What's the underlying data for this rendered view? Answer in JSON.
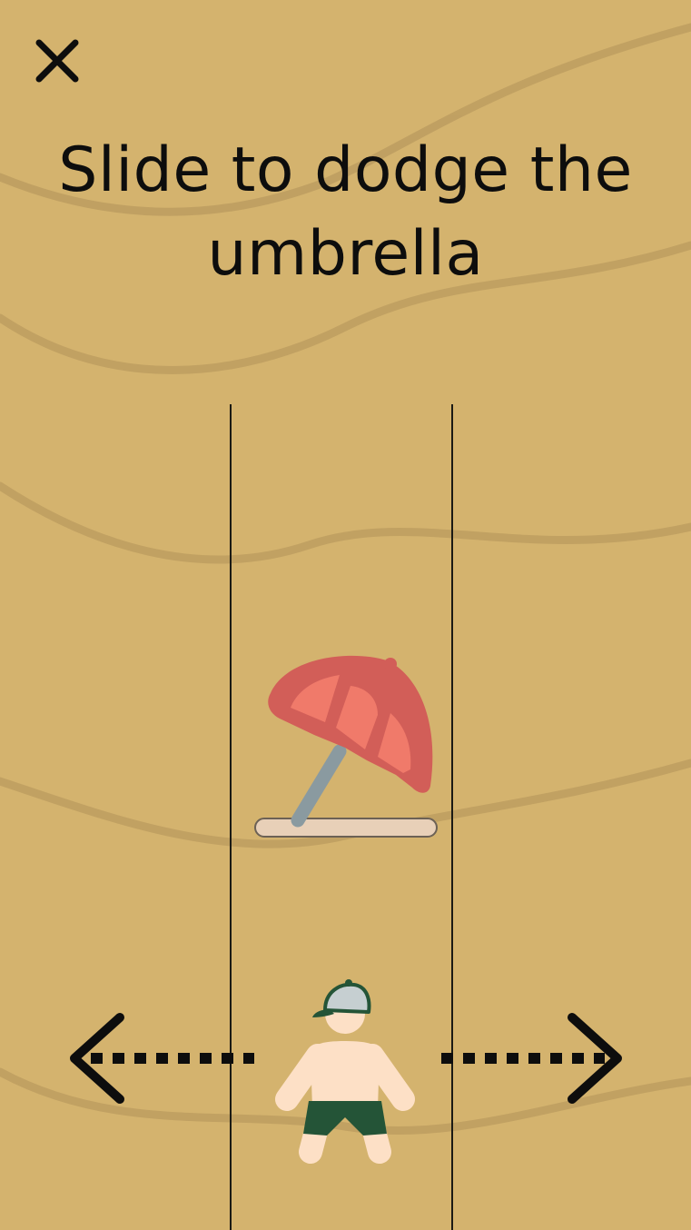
{
  "game": {
    "instruction": "Slide to dodge the umbrella",
    "close_icon": "close-icon",
    "lanes": 3,
    "umbrella_lane": "center",
    "player_lane": "center",
    "obstacle_icon": "beach-umbrella-icon",
    "player_icon": "beachgoer-icon",
    "controls": {
      "left_icon": "arrow-left-icon",
      "right_icon": "arrow-right-icon"
    }
  },
  "colors": {
    "sand": "#d4b36e",
    "text": "#0d0d0d",
    "umbrella_canopy": "#d25e58",
    "umbrella_panel": "#f07a6a",
    "umbrella_pole": "#8a9aa0",
    "umbrella_base": "#e8d0b8",
    "skin": "#fde0c6",
    "shorts": "#245437",
    "cap": "#c6cfd1"
  }
}
